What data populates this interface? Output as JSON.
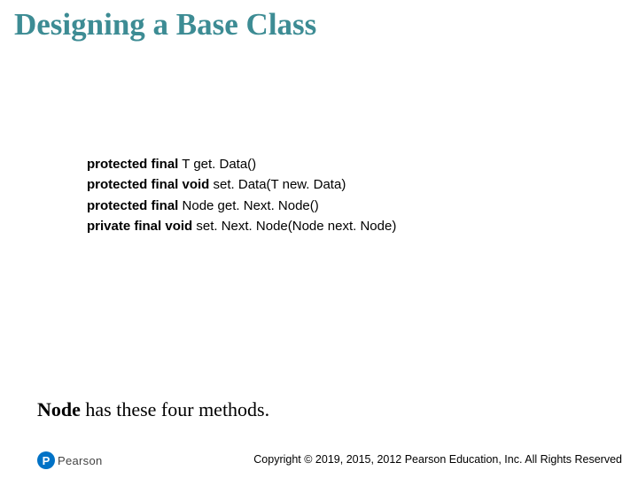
{
  "title": "Designing a Base Class",
  "code": {
    "lines": [
      {
        "kw": "protected final",
        "rest": " T get. Data()"
      },
      {
        "kw": "protected final void",
        "rest": " set. Data(T new. Data)"
      },
      {
        "kw": "protected final",
        "rest": " Node get. Next. Node()"
      },
      {
        "kw": "private final void",
        "rest": " set. Next. Node(Node next. Node)"
      }
    ]
  },
  "subtitle": {
    "node": "Node",
    "rest": " has these four methods."
  },
  "logo": {
    "initial": "P",
    "brand": "Pearson"
  },
  "copyright": "Copyright © 2019, 2015, 2012 Pearson Education, Inc. All Rights Reserved"
}
